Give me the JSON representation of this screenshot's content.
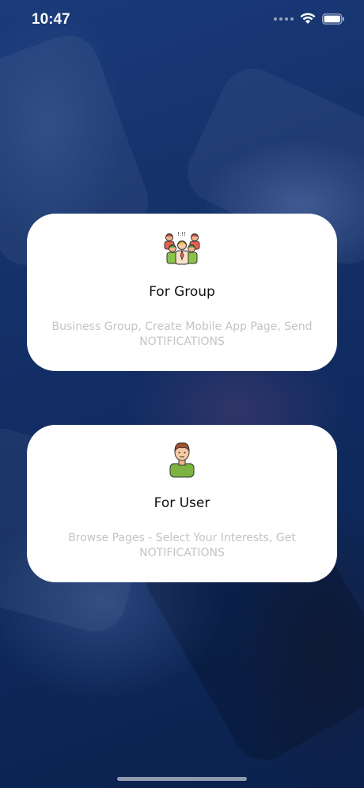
{
  "status_bar": {
    "time": "10:47",
    "icons": [
      "signal-dots-icon",
      "wifi-icon",
      "battery-icon"
    ]
  },
  "cards": [
    {
      "title": "For Group",
      "description": "Business Group, Create Mobile App Page, Send NOTIFICATIONS",
      "icon": "group-icon"
    },
    {
      "title": "For User",
      "description": "Browse Pages - Select Your Interests, Get NOTIFICATIONS",
      "icon": "user-icon"
    }
  ],
  "colors": {
    "background": "#0e2a5c",
    "card": "#ffffff",
    "title": "#111111",
    "description": "#c4c4c4"
  }
}
